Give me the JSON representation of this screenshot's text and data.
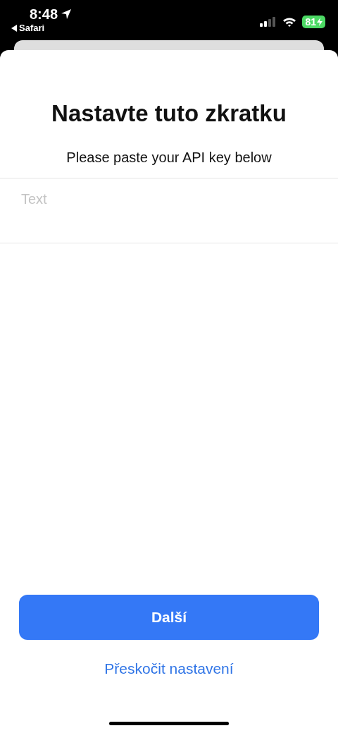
{
  "status_bar": {
    "time": "8:48",
    "back_app": "Safari",
    "battery": "81"
  },
  "sheet": {
    "title": "Nastavte tuto zkratku",
    "prompt": "Please paste your API key below",
    "field": {
      "placeholder": "Text"
    }
  },
  "buttons": {
    "primary": "Další",
    "secondary": "Přeskočit nastavení"
  }
}
